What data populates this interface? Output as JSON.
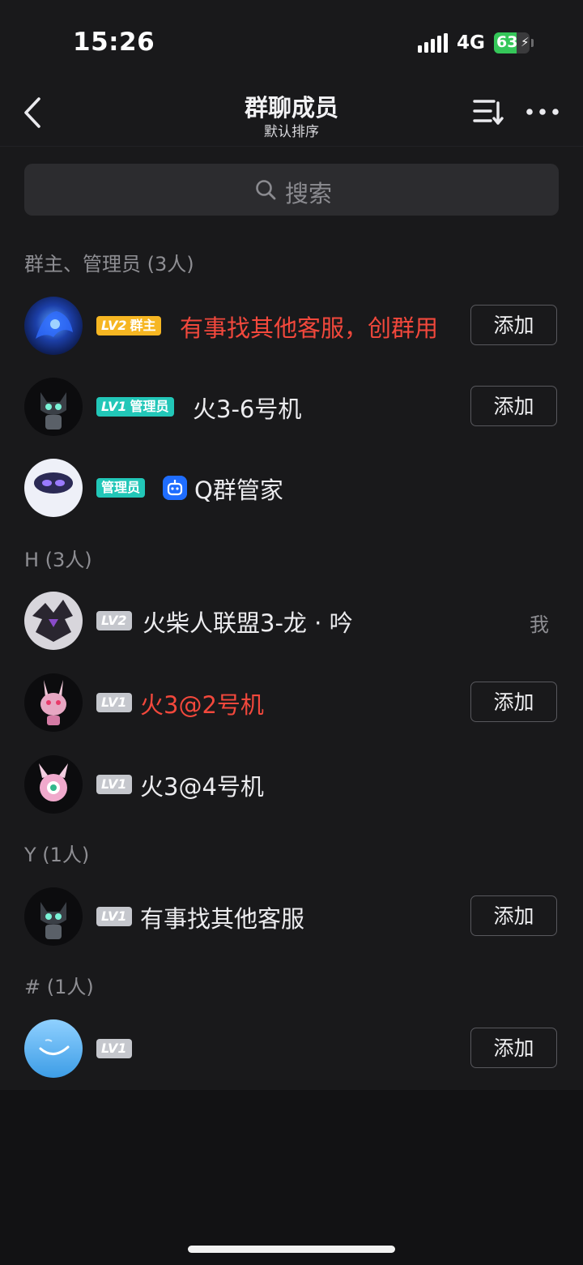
{
  "status_bar": {
    "time": "15:26",
    "network": "4G",
    "battery": 63
  },
  "header": {
    "title": "群聊成员",
    "subtitle": "默认排序"
  },
  "search": {
    "placeholder": "搜索"
  },
  "sections": [
    {
      "label": "群主、管理员 (3人)",
      "members": [
        {
          "level": "LV2",
          "role": "群主",
          "name": "有事找其他客服，创群用",
          "action": "添加"
        },
        {
          "level": "LV1",
          "role": "管理员",
          "name": "火3-6号机",
          "action": "添加"
        },
        {
          "role": "管理员",
          "name": "Q群管家"
        }
      ]
    },
    {
      "label": "H (3人)",
      "members": [
        {
          "level": "LV2",
          "name": "火柴人联盟3-龙 · 吟",
          "self_label": "我"
        },
        {
          "level": "LV1",
          "name": "火3@2号机",
          "action": "添加"
        },
        {
          "level": "LV1",
          "name": "火3@4号机"
        }
      ]
    },
    {
      "label": "Y (1人)",
      "members": [
        {
          "level": "LV1",
          "name": "有事找其他客服",
          "action": "添加"
        }
      ]
    },
    {
      "label": "# (1人)",
      "members": [
        {
          "level": "LV1",
          "name": "",
          "action": "添加"
        }
      ]
    }
  ],
  "colors": {
    "background": "#19191b",
    "owner_badge": "#f6b622",
    "admin_badge": "#22c7b8",
    "level_badge": "#c5c7cd",
    "highlight_name": "#f2483c",
    "bot_icon": "#1f6dff"
  },
  "icons": [
    "back-chevron-icon",
    "sort-icon",
    "more-dots-icon",
    "search-icon",
    "robot-icon"
  ]
}
